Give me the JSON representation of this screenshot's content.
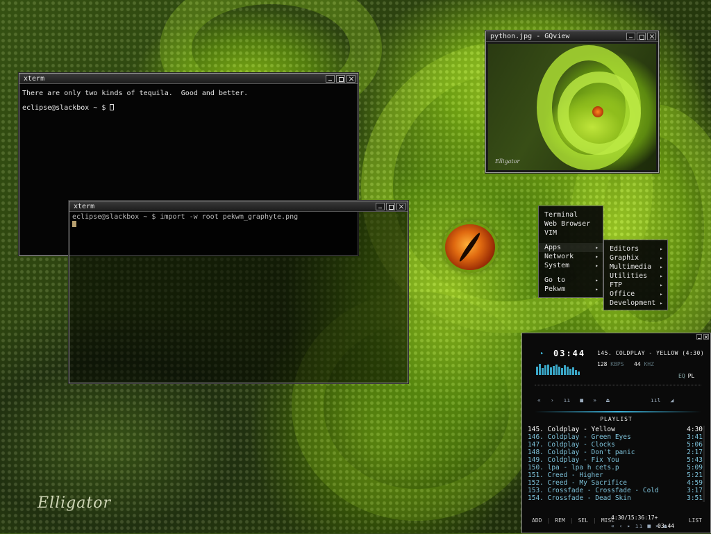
{
  "wallpaper": {
    "signature": "Elligator"
  },
  "xterm1": {
    "title": "xterm",
    "lines": [
      "There are only two kinds of tequila.  Good and better.",
      "eclipse@slackbox ~ $ "
    ]
  },
  "xterm2": {
    "title": "xterm",
    "lines": [
      "eclipse@slackbox ~ $ import -w root pekwm_graphyte.png"
    ]
  },
  "gqview": {
    "title": "python.jpg - GQview",
    "image_signature": "Elligator"
  },
  "root_menu": {
    "groups": [
      [
        {
          "label": "Terminal",
          "submenu": false
        },
        {
          "label": "Web Browser",
          "submenu": false
        },
        {
          "label": "VIM",
          "submenu": false
        }
      ],
      [
        {
          "label": "Apps",
          "submenu": true
        },
        {
          "label": "Network",
          "submenu": true
        },
        {
          "label": "System",
          "submenu": true
        }
      ],
      [
        {
          "label": "Go to",
          "submenu": true
        },
        {
          "label": "Pekwm",
          "submenu": true
        }
      ]
    ]
  },
  "apps_menu": {
    "items": [
      {
        "label": "Editors",
        "submenu": true
      },
      {
        "label": "Graphix",
        "submenu": true
      },
      {
        "label": "Multimedia",
        "submenu": true
      },
      {
        "label": "Utilities",
        "submenu": true
      },
      {
        "label": "FTP",
        "submenu": true
      },
      {
        "label": "Office",
        "submenu": true
      },
      {
        "label": "Development",
        "submenu": true
      }
    ]
  },
  "xmms": {
    "time": "03:44",
    "song": "145. COLDPLAY - YELLOW (4:30)",
    "kbps": "128",
    "kbps_label": "KBPS",
    "khz": "44",
    "khz_label": "KHZ",
    "eq_label": "EQ",
    "pl_label": "PL",
    "controls": [
      "«",
      "›",
      "ıı",
      "■",
      "»",
      "⏏"
    ],
    "extra_controls": [
      "ııl",
      "◢"
    ],
    "playlist_label": "PLAYLIST",
    "playlist": [
      {
        "title": "145. Coldplay - Yellow",
        "length": "4:30",
        "current": true
      },
      {
        "title": "146. Coldplay - Green Eyes",
        "length": "3:41",
        "current": false
      },
      {
        "title": "147. Coldplay - Clocks",
        "length": "5:06",
        "current": false
      },
      {
        "title": "148. Coldplay - Don't panic",
        "length": "2:17",
        "current": false
      },
      {
        "title": "149. Coldplay - Fix You",
        "length": "5:43",
        "current": false
      },
      {
        "title": "150. lpa - lpa  h cets.p",
        "length": "5:09",
        "current": false
      },
      {
        "title": "151. Creed - Higher",
        "length": "5:21",
        "current": false
      },
      {
        "title": "152. Creed - My Sacrifice",
        "length": "4:59",
        "current": false
      },
      {
        "title": "153. Crossfade - Crossfade - Cold",
        "length": "3:17",
        "current": false
      },
      {
        "title": "154. Crossfade - Dead Skin",
        "length": "3:51",
        "current": false
      }
    ],
    "bottom_buttons": [
      "ADD",
      "REM",
      "SEL",
      "MISC"
    ],
    "status": "4:30/15:36:17+",
    "mini_controls": "« ‹ ▸ ıı ■ » ⏏",
    "mini_time": "03:44",
    "list_label": "LIST"
  },
  "colors": {
    "accent": "#3cb4dc",
    "terminal_bg": "#050505",
    "menu_bg": "#080808"
  }
}
